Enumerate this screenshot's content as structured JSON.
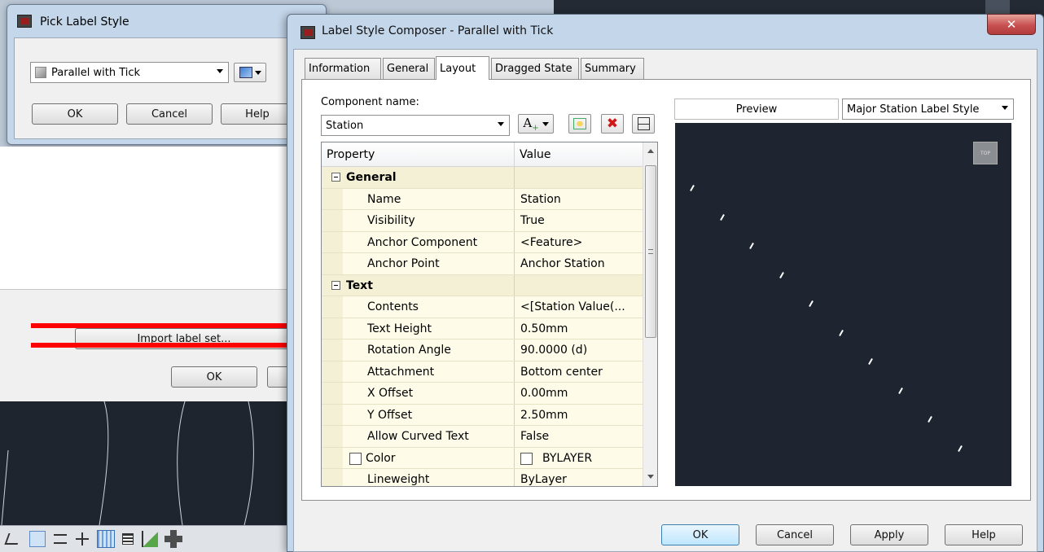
{
  "pick_dialog": {
    "title": "Pick Label Style",
    "style_value": "Parallel with Tick",
    "buttons": {
      "ok": "OK",
      "cancel": "Cancel",
      "help": "Help"
    }
  },
  "behind_dialog": {
    "import_label": "Import label set...",
    "ok": "OK"
  },
  "composer": {
    "title": "Label Style Composer - Parallel with Tick",
    "close_glyph": "✕",
    "tabs": [
      "Information",
      "General",
      "Layout",
      "Dragged State",
      "Summary"
    ],
    "active_tab": "Layout",
    "component_name_label": "Component name:",
    "component_name_value": "Station",
    "grid": {
      "header_property": "Property",
      "header_value": "Value",
      "rows": [
        {
          "kind": "cat",
          "label": "General"
        },
        {
          "kind": "prop",
          "label": "Name",
          "value": "Station"
        },
        {
          "kind": "prop",
          "label": "Visibility",
          "value": "True"
        },
        {
          "kind": "prop",
          "label": "Anchor Component",
          "value": "<Feature>"
        },
        {
          "kind": "prop",
          "label": "Anchor Point",
          "value": "Anchor Station"
        },
        {
          "kind": "cat",
          "label": "Text"
        },
        {
          "kind": "prop",
          "label": "Contents",
          "value": "<[Station Value(..."
        },
        {
          "kind": "prop",
          "label": "Text Height",
          "value": "0.50mm"
        },
        {
          "kind": "prop",
          "label": "Rotation Angle",
          "value": "90.0000 (d)"
        },
        {
          "kind": "prop",
          "label": "Attachment",
          "value": "Bottom center"
        },
        {
          "kind": "prop",
          "label": "X Offset",
          "value": "0.00mm"
        },
        {
          "kind": "prop",
          "label": "Y Offset",
          "value": "2.50mm"
        },
        {
          "kind": "prop",
          "label": "Allow Curved Text",
          "value": "False"
        },
        {
          "kind": "check",
          "label": "Color",
          "value": "BYLAYER"
        },
        {
          "kind": "prop",
          "label": "Lineweight",
          "value": "ByLayer"
        }
      ]
    },
    "preview_label": "Preview",
    "preview_style": "Major Station Label Style",
    "viewcube_label": "TOP",
    "buttons": {
      "ok": "OK",
      "cancel": "Cancel",
      "apply": "Apply",
      "help": "Help"
    }
  },
  "colors": {
    "annotation_arrow": "#ff0000",
    "preview_bg": "#1e2530",
    "titlebar": "#b9d1ea",
    "close_button": "#c75050"
  }
}
